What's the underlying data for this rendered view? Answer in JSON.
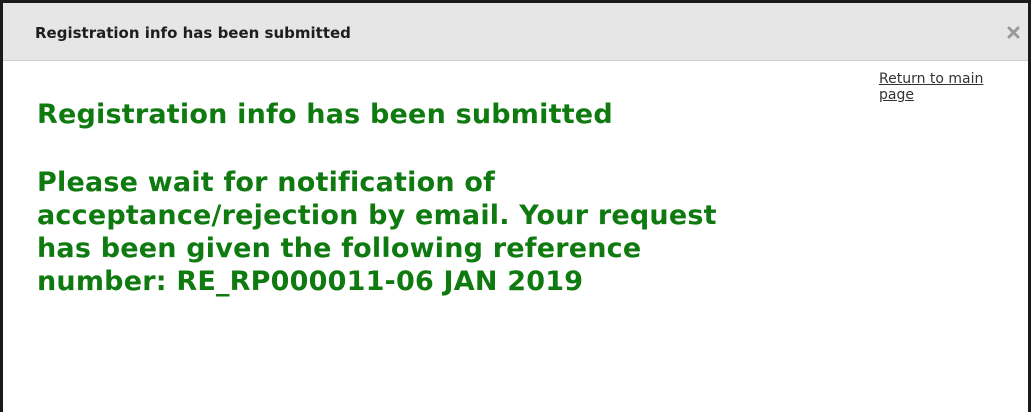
{
  "dialog": {
    "title": "Registration info has been submitted",
    "close_icon": "close-icon"
  },
  "content": {
    "return_link": "Return to main page",
    "heading": "Registration info has been submitted",
    "message": "Please wait for notification of acceptance/rejection by email. Your request has been given the following reference number: RE_RP000011-06 JAN 2019"
  },
  "colors": {
    "heading_green": "#0f7a0f",
    "titlebar_bg": "#e6e6e6",
    "border": "#1a1a1a"
  }
}
